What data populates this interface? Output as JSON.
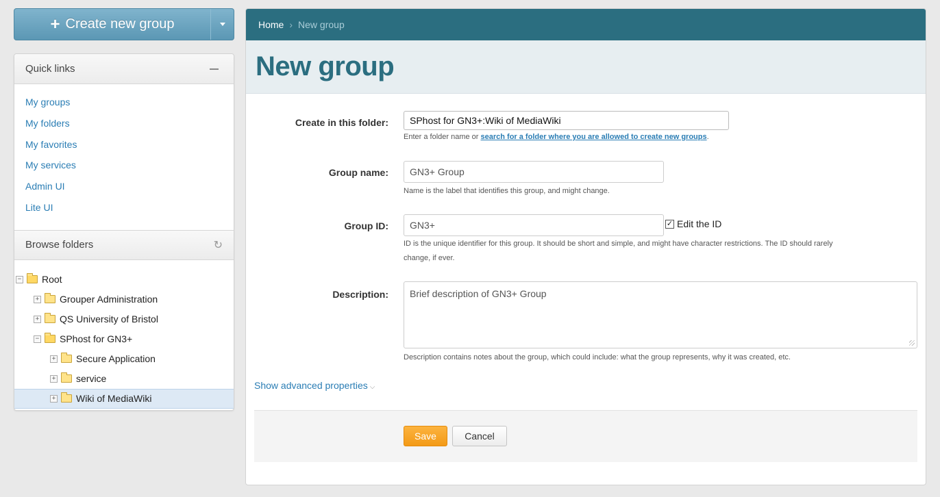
{
  "create_button": {
    "label": "Create new group",
    "plus": "+"
  },
  "quick_links": {
    "title": "Quick links",
    "items": [
      {
        "label": "My groups"
      },
      {
        "label": "My folders"
      },
      {
        "label": "My favorites"
      },
      {
        "label": "My services"
      },
      {
        "label": "Admin UI"
      },
      {
        "label": "Lite UI"
      }
    ]
  },
  "browse_folders": {
    "title": "Browse folders",
    "tree": [
      {
        "label": "Root",
        "expander": "−",
        "open": true
      },
      {
        "label": "Grouper Administration",
        "expander": "+"
      },
      {
        "label": "QS University of Bristol",
        "expander": "+"
      },
      {
        "label": "SPhost for GN3+",
        "expander": "−",
        "open": true
      },
      {
        "label": "Secure Application",
        "expander": "+"
      },
      {
        "label": "service",
        "expander": "+"
      },
      {
        "label": "Wiki of MediaWiki",
        "expander": "+",
        "selected": true
      }
    ]
  },
  "breadcrumb": {
    "home": "Home",
    "separator": "›",
    "current": "New group"
  },
  "page_title": "New group",
  "form": {
    "folder": {
      "label": "Create in this folder:",
      "value": "SPhost for GN3+:Wiki of MediaWiki",
      "help_prefix": "Enter a folder name or ",
      "help_link": "search for a folder where you are allowed to create new groups",
      "help_suffix": "."
    },
    "group_name": {
      "label": "Group name:",
      "value": "GN3+ Group",
      "help": "Name is the label that identifies this group, and might change."
    },
    "group_id": {
      "label": "Group ID:",
      "value": "GN3+",
      "edit_label": "Edit the ID",
      "edit_checked": true,
      "help_line1": "ID is the unique identifier for this group. It should be short and simple, and might have character restrictions. The ID should rarely",
      "help_line2": "change, if ever."
    },
    "description": {
      "label": "Description:",
      "value": "Brief description of GN3+ Group",
      "help": "Description contains notes about the group, which could include: what the group represents, why it was created, etc."
    },
    "advanced_link": "Show advanced properties",
    "save_label": "Save",
    "cancel_label": "Cancel"
  },
  "colors": {
    "brand_teal": "#2b6e80",
    "link_blue": "#2a7db4",
    "save_orange": "#f39a17",
    "create_blue": "#5b97b4"
  }
}
